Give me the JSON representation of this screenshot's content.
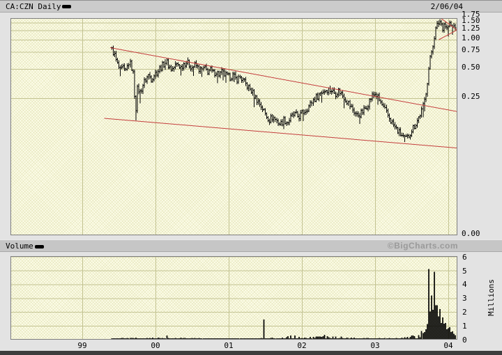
{
  "window": {
    "title": "CA:CZN Daily",
    "date": "2/06/04"
  },
  "volume_header": {
    "label": "Volume",
    "brand": "©BigCharts.com"
  },
  "colors": {
    "bars": "#000000",
    "trendline": "#c43c3c",
    "grid": "#c3c392",
    "plot_bg": "#fdfde9",
    "strip_bg": "#c9c9c9",
    "page_bg": "#e3e3e3",
    "brand_text": "#9a9a9a"
  },
  "time_axis": {
    "years": [
      1999,
      2000,
      2001,
      2002,
      2003,
      2004
    ],
    "labels": [
      "99",
      "00",
      "01",
      "02",
      "03",
      "04"
    ]
  },
  "chart_data": [
    {
      "type": "ohlc",
      "name": "price",
      "symbol": "CA:CZN",
      "frequency": "Daily",
      "scale": "log",
      "x_unit": "decimal_year",
      "x_range": [
        1999.4,
        2004.1
      ],
      "y_ticks": [
        1.75,
        1.5,
        1.25,
        1.0,
        0.75,
        0.5,
        0.25,
        0.0
      ],
      "keyframes": [
        [
          1999.4,
          0.79
        ],
        [
          1999.43,
          0.73
        ],
        [
          1999.46,
          0.6
        ],
        [
          1999.49,
          0.52
        ],
        [
          1999.52,
          0.47
        ],
        [
          1999.55,
          0.52
        ],
        [
          1999.58,
          0.45
        ],
        [
          1999.61,
          0.52
        ],
        [
          1999.63,
          0.58
        ],
        [
          1999.66,
          0.55
        ],
        [
          1999.69,
          0.44
        ],
        [
          1999.72,
          0.16
        ],
        [
          1999.75,
          0.33
        ],
        [
          1999.78,
          0.28
        ],
        [
          1999.82,
          0.34
        ],
        [
          1999.86,
          0.39
        ],
        [
          1999.9,
          0.43
        ],
        [
          1999.94,
          0.4
        ],
        [
          1999.98,
          0.44
        ],
        [
          2000.02,
          0.47
        ],
        [
          2000.06,
          0.51
        ],
        [
          2000.1,
          0.55
        ],
        [
          2000.14,
          0.6
        ],
        [
          2000.18,
          0.53
        ],
        [
          2000.22,
          0.49
        ],
        [
          2000.26,
          0.54
        ],
        [
          2000.3,
          0.56
        ],
        [
          2000.34,
          0.52
        ],
        [
          2000.38,
          0.57
        ],
        [
          2000.42,
          0.59
        ],
        [
          2000.46,
          0.55
        ],
        [
          2000.5,
          0.52
        ],
        [
          2000.54,
          0.55
        ],
        [
          2000.58,
          0.51
        ],
        [
          2000.62,
          0.48
        ],
        [
          2000.66,
          0.51
        ],
        [
          2000.7,
          0.47
        ],
        [
          2000.74,
          0.49
        ],
        [
          2000.78,
          0.45
        ],
        [
          2000.82,
          0.47
        ],
        [
          2000.86,
          0.44
        ],
        [
          2000.9,
          0.46
        ],
        [
          2000.95,
          0.43
        ],
        [
          2001.0,
          0.41
        ],
        [
          2001.05,
          0.43
        ],
        [
          2001.1,
          0.39
        ],
        [
          2001.15,
          0.41
        ],
        [
          2001.2,
          0.37
        ],
        [
          2001.25,
          0.33
        ],
        [
          2001.3,
          0.3
        ],
        [
          2001.35,
          0.26
        ],
        [
          2001.4,
          0.23
        ],
        [
          2001.45,
          0.2
        ],
        [
          2001.5,
          0.17
        ],
        [
          2001.55,
          0.15
        ],
        [
          2001.6,
          0.16
        ],
        [
          2001.65,
          0.145
        ],
        [
          2001.7,
          0.135
        ],
        [
          2001.75,
          0.15
        ],
        [
          2001.8,
          0.14
        ],
        [
          2001.85,
          0.16
        ],
        [
          2001.9,
          0.17
        ],
        [
          2001.95,
          0.16
        ],
        [
          2002.0,
          0.175
        ],
        [
          2002.05,
          0.19
        ],
        [
          2002.1,
          0.21
        ],
        [
          2002.15,
          0.24
        ],
        [
          2002.2,
          0.26
        ],
        [
          2002.25,
          0.285
        ],
        [
          2002.3,
          0.3
        ],
        [
          2002.35,
          0.31
        ],
        [
          2002.4,
          0.3
        ],
        [
          2002.45,
          0.28
        ],
        [
          2002.5,
          0.3
        ],
        [
          2002.55,
          0.27
        ],
        [
          2002.6,
          0.24
        ],
        [
          2002.65,
          0.21
        ],
        [
          2002.7,
          0.185
        ],
        [
          2002.75,
          0.165
        ],
        [
          2002.8,
          0.175
        ],
        [
          2002.85,
          0.19
        ],
        [
          2002.9,
          0.22
        ],
        [
          2002.95,
          0.26
        ],
        [
          2003.0,
          0.28
        ],
        [
          2003.05,
          0.24
        ],
        [
          2003.1,
          0.205
        ],
        [
          2003.15,
          0.175
        ],
        [
          2003.2,
          0.15
        ],
        [
          2003.25,
          0.13
        ],
        [
          2003.3,
          0.115
        ],
        [
          2003.35,
          0.105
        ],
        [
          2003.4,
          0.095
        ],
        [
          2003.45,
          0.1
        ],
        [
          2003.5,
          0.12
        ],
        [
          2003.55,
          0.135
        ],
        [
          2003.58,
          0.15
        ],
        [
          2003.61,
          0.17
        ],
        [
          2003.64,
          0.19
        ],
        [
          2003.67,
          0.24
        ],
        [
          2003.7,
          0.33
        ],
        [
          2003.72,
          0.45
        ],
        [
          2003.74,
          0.6
        ],
        [
          2003.76,
          0.72
        ],
        [
          2003.78,
          0.85
        ],
        [
          2003.8,
          1.05
        ],
        [
          2003.82,
          1.25
        ],
        [
          2003.85,
          1.45
        ],
        [
          2003.88,
          1.55
        ],
        [
          2003.9,
          1.45
        ],
        [
          2003.92,
          1.35
        ],
        [
          2003.94,
          1.48
        ],
        [
          2003.96,
          1.38
        ],
        [
          2003.98,
          1.28
        ],
        [
          2004.0,
          1.4
        ],
        [
          2004.02,
          1.46
        ],
        [
          2004.04,
          1.35
        ],
        [
          2004.06,
          1.32
        ],
        [
          2004.08,
          1.4
        ],
        [
          2004.1,
          1.38
        ]
      ],
      "spike_lows": [
        [
          1999.72,
          0.147
        ],
        [
          1999.78,
          0.22
        ],
        [
          2001.52,
          0.16
        ],
        [
          2001.74,
          0.12
        ],
        [
          2003.4,
          0.088
        ],
        [
          2000.95,
          0.36
        ]
      ],
      "spike_highs": [
        [
          2003.88,
          1.66
        ],
        [
          2000.14,
          0.63
        ],
        [
          1999.41,
          0.87
        ]
      ],
      "trendlines": [
        {
          "name": "upper-channel",
          "from": [
            1999.38,
            0.83
          ],
          "to": [
            2004.16,
            0.18
          ]
        },
        {
          "name": "lower-channel",
          "from": [
            1999.3,
            0.155
          ],
          "to": [
            2004.16,
            0.076
          ]
        },
        {
          "name": "pennant-top",
          "from": [
            2003.9,
            1.66
          ],
          "to": [
            2004.12,
            1.26
          ]
        },
        {
          "name": "pennant-bottom",
          "from": [
            2003.87,
            1.0
          ],
          "to": [
            2004.12,
            1.26
          ]
        }
      ]
    },
    {
      "type": "bar",
      "name": "volume",
      "unit_label": "Millions",
      "y_ticks": [
        6,
        5,
        4,
        3,
        2,
        1,
        0
      ],
      "baseline_keyframes": [
        [
          1999.4,
          0.06
        ],
        [
          1999.7,
          0.08
        ],
        [
          2000.0,
          0.1
        ],
        [
          2000.2,
          0.14
        ],
        [
          2000.4,
          0.09
        ],
        [
          2000.7,
          0.06
        ],
        [
          2001.0,
          0.05
        ],
        [
          2001.3,
          0.06
        ],
        [
          2001.6,
          0.09
        ],
        [
          2001.85,
          0.17
        ],
        [
          2002.0,
          0.12
        ],
        [
          2002.2,
          0.16
        ],
        [
          2002.4,
          0.18
        ],
        [
          2002.6,
          0.1
        ],
        [
          2002.9,
          0.07
        ],
        [
          2003.2,
          0.08
        ],
        [
          2003.4,
          0.12
        ],
        [
          2003.55,
          0.22
        ],
        [
          2003.62,
          0.35
        ],
        [
          2003.67,
          0.55
        ],
        [
          2003.7,
          0.85
        ],
        [
          2003.74,
          2.2
        ],
        [
          2003.78,
          2.6
        ],
        [
          2003.82,
          3.0
        ],
        [
          2003.86,
          1.9
        ],
        [
          2003.9,
          1.4
        ],
        [
          2003.95,
          1.0
        ],
        [
          2004.0,
          0.75
        ],
        [
          2004.05,
          0.5
        ],
        [
          2004.1,
          0.3
        ]
      ],
      "spikes": [
        [
          2000.15,
          0.3
        ],
        [
          2001.48,
          1.45
        ],
        [
          2001.9,
          0.3
        ],
        [
          2002.3,
          0.35
        ],
        [
          2003.72,
          5.1
        ],
        [
          2003.76,
          3.2
        ],
        [
          2003.8,
          4.9
        ],
        [
          2003.84,
          2.5
        ],
        [
          2003.88,
          2.2
        ],
        [
          2003.92,
          1.6
        ],
        [
          2003.96,
          1.2
        ],
        [
          2004.02,
          0.9
        ],
        [
          2004.06,
          0.6
        ]
      ]
    }
  ]
}
